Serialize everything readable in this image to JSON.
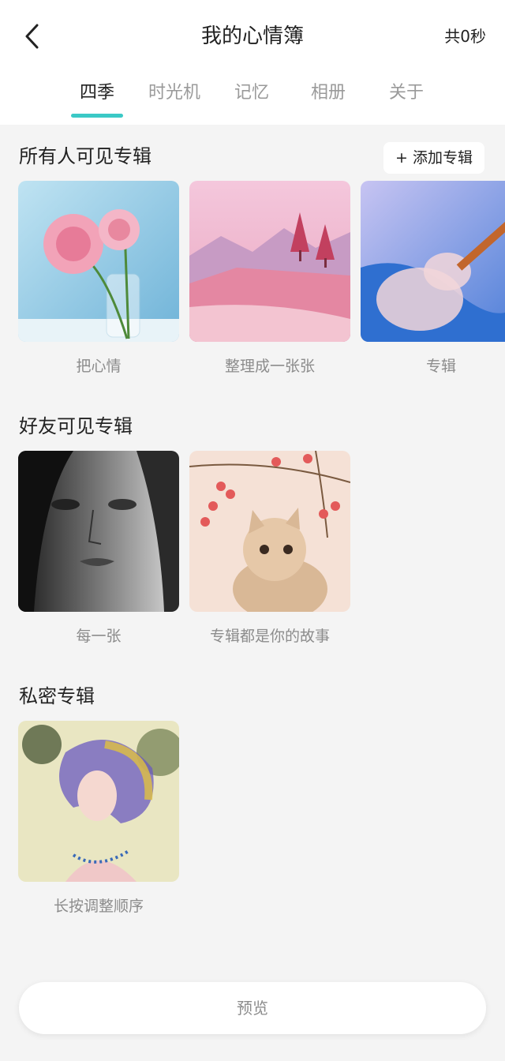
{
  "header": {
    "title": "我的心情簿",
    "duration": "共0秒"
  },
  "tabs": [
    {
      "label": "四季"
    },
    {
      "label": "时光机"
    },
    {
      "label": "记忆"
    },
    {
      "label": "相册"
    },
    {
      "label": "关于"
    }
  ],
  "active_tab": "四季",
  "add_album_label": "+ 添加专辑",
  "sections": {
    "public": {
      "title": "所有人可见专辑",
      "albums": [
        {
          "caption": "把心情",
          "image": "pink-flowers-in-vase"
        },
        {
          "caption": "整理成一张张",
          "image": "pink-landscape-with-trees"
        },
        {
          "caption": "专辑",
          "image": "violin-in-blue-water"
        }
      ]
    },
    "friends": {
      "title": "好友可见专辑",
      "albums": [
        {
          "caption": "每一张",
          "image": "black-white-face-portrait"
        },
        {
          "caption": "专辑都是你的故事",
          "image": "kitten-under-berry-branches"
        }
      ]
    },
    "private": {
      "title": "私密专辑",
      "albums": [
        {
          "caption": "长按调整顺序",
          "image": "watercolor-girl-portrait"
        }
      ]
    }
  },
  "preview_label": "预览",
  "colors": {
    "accent": "#3bc9c6",
    "background": "#f4f4f4",
    "header_bg": "#ffffff",
    "caption": "#8c8c8c"
  },
  "icons": {
    "back": "chevron-left-icon"
  }
}
